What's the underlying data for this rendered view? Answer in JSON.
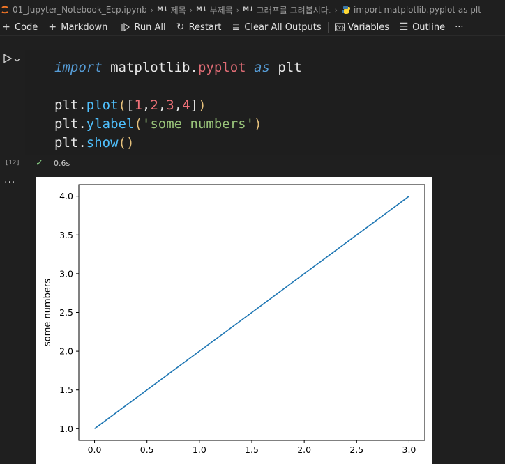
{
  "breadcrumb": {
    "notebook": "01_Jupyter_Notebook_Ecp.ipynb",
    "md_badge": "M↓",
    "h1": "제목",
    "h2": "부제목",
    "h3": "그래프를 그려봅시다.",
    "code_cell": "import matplotlib.pyplot as plt"
  },
  "toolbar": {
    "code": "Code",
    "markdown": "Markdown",
    "run_all": "Run All",
    "restart": "Restart",
    "clear_outputs": "Clear All Outputs",
    "variables": "Variables",
    "outline": "Outline",
    "more": "···"
  },
  "cell": {
    "execution_count": "[12]",
    "duration": "0.6s",
    "output_menu": "···",
    "code": {
      "import_kw": "import",
      "module": "matplotlib",
      "dot": ".",
      "submodule": "pyplot",
      "as_kw": "as",
      "alias": "plt",
      "plot_fn": "plot",
      "ylabel_fn": "ylabel",
      "show_fn": "show",
      "list_values": [
        "1",
        "2",
        "3",
        "4"
      ],
      "ylabel_arg": "'some numbers'"
    }
  },
  "chart_data": {
    "type": "line",
    "title": "",
    "xlabel": "",
    "ylabel": "some numbers",
    "x": [
      0,
      1,
      2,
      3
    ],
    "series": [
      {
        "values": [
          1,
          2,
          3,
          4
        ],
        "color": "#1f77b4"
      }
    ],
    "xlim": [
      -0.15,
      3.15
    ],
    "ylim": [
      0.85,
      4.15
    ],
    "xticks": [
      "0.0",
      "0.5",
      "1.0",
      "1.5",
      "2.0",
      "2.5",
      "3.0"
    ],
    "yticks": [
      "1.0",
      "1.5",
      "2.0",
      "2.5",
      "3.0",
      "3.5",
      "4.0"
    ],
    "grid": false
  },
  "colors": {
    "accent_check": "#89d185",
    "background": "#1f1f1f",
    "editor_bg": "#1e1e1e"
  }
}
